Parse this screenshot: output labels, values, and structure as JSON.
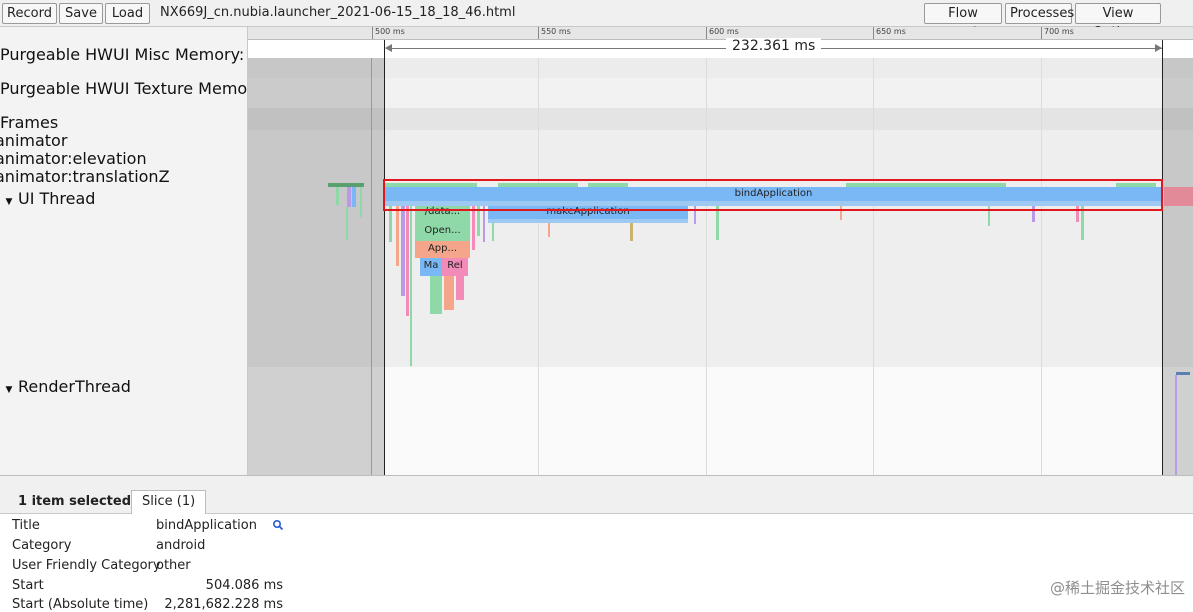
{
  "toolbar": {
    "record_label": "Record",
    "save_label": "Save",
    "load_label": "Load",
    "file_title": "NX669J_cn.nubia.launcher_2021-06-15_18_18_46.html",
    "flow_events_label": "Flow events",
    "processes_label": "Processes",
    "view_options_label": "View Options"
  },
  "tracks": [
    {
      "label": "Purgeable HWUI Misc Memory:"
    },
    {
      "label": "Purgeable HWUI Texture Memo"
    },
    {
      "label": "Frames"
    },
    {
      "label": "animator"
    },
    {
      "label": "animator:elevation"
    },
    {
      "label": "animator:translationZ"
    },
    {
      "label": "UI Thread",
      "expander": "▼"
    },
    {
      "label": "RenderThread",
      "expander": "▼"
    }
  ],
  "ruler": {
    "ticks": [
      "500 ms",
      "550 ms",
      "600 ms",
      "650 ms",
      "700 ms"
    ],
    "measure_label": "232.361 ms"
  },
  "slices": {
    "bind_application": "bindApplication",
    "make_application": "makeApplication",
    "data": "/data...",
    "open": "Open...",
    "app": "App...",
    "ma": "Ma",
    "rel": "Rel"
  },
  "colors": {
    "bind_application": "#7ab8f5",
    "make_application": "#7ab8f5",
    "green": "#8fd9a8",
    "salmon": "#f4a58a",
    "pink": "#f28bb8",
    "purple": "#b89ae6",
    "selection": "#e0181d"
  },
  "bottom": {
    "selected_count": "1 item selected.",
    "tab_label": "Slice (1)",
    "properties": [
      {
        "key": "Title",
        "value": "bindApplication"
      },
      {
        "key": "Category",
        "value": "android"
      },
      {
        "key": "User Friendly Category",
        "value": "other"
      },
      {
        "key": "Start",
        "value": "504.086 ms"
      },
      {
        "key": "Start (Absolute time)",
        "value": "2,281,682.228 ms"
      }
    ],
    "watermark": "@稀土掘金技术社区"
  }
}
